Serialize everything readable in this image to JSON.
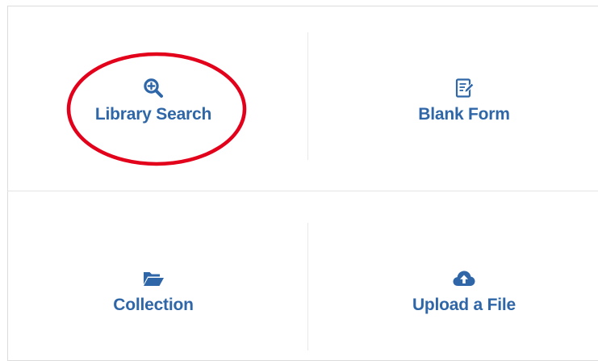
{
  "tiles": {
    "library_search": {
      "label": "Library Search",
      "icon": "search-plus-icon"
    },
    "blank_form": {
      "label": "Blank Form",
      "icon": "edit-document-icon"
    },
    "collection": {
      "label": "Collection",
      "icon": "folder-open-icon"
    },
    "upload_file": {
      "label": "Upload a File",
      "icon": "cloud-upload-icon"
    }
  },
  "colors": {
    "accent": "#2e66a8",
    "annotation": "#e3001b",
    "divider": "#e4e4e4"
  },
  "annotation": {
    "shape": "ellipse",
    "highlights": "library_search"
  }
}
